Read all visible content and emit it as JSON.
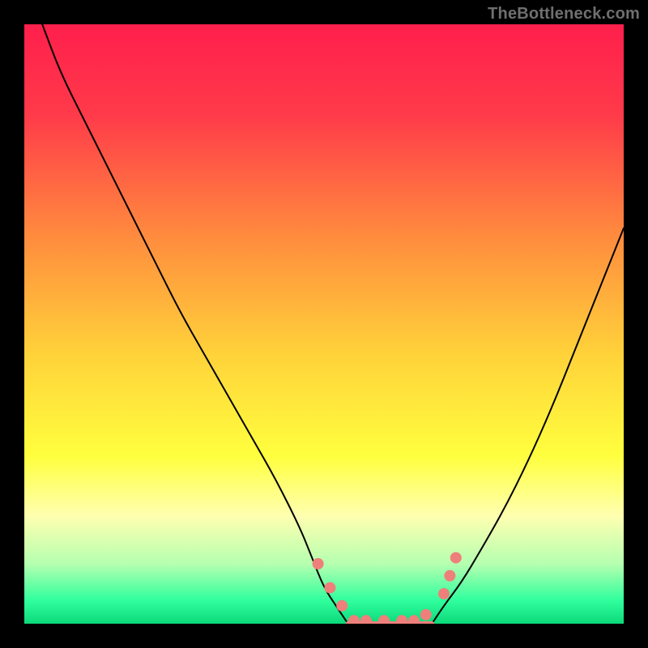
{
  "watermark": "TheBottleneck.com",
  "chart_data": {
    "type": "line",
    "title": "",
    "xlabel": "",
    "ylabel": "",
    "xlim": [
      0,
      100
    ],
    "ylim": [
      0,
      100
    ],
    "grid": false,
    "legend": false,
    "background_gradient": {
      "stops": [
        {
          "offset": 0.0,
          "color": "#ff1f4c"
        },
        {
          "offset": 0.15,
          "color": "#ff3a4a"
        },
        {
          "offset": 0.35,
          "color": "#ff8a3e"
        },
        {
          "offset": 0.55,
          "color": "#ffd23a"
        },
        {
          "offset": 0.72,
          "color": "#ffff3e"
        },
        {
          "offset": 0.82,
          "color": "#ffffb0"
        },
        {
          "offset": 0.9,
          "color": "#b6ffb0"
        },
        {
          "offset": 0.96,
          "color": "#32ff9e"
        },
        {
          "offset": 1.0,
          "color": "#0cd97a"
        }
      ]
    },
    "series": [
      {
        "name": "left-curve",
        "color": "#000000",
        "width": 2,
        "x": [
          3,
          6,
          10,
          14,
          18,
          22,
          26,
          30,
          34,
          38,
          42,
          46,
          48,
          50,
          52,
          54
        ],
        "y": [
          100,
          92,
          84,
          76,
          68,
          60,
          52,
          45,
          38,
          31,
          24,
          16,
          11,
          6,
          3,
          0
        ]
      },
      {
        "name": "right-curve",
        "color": "#000000",
        "width": 2,
        "x": [
          68,
          70,
          73,
          76,
          80,
          84,
          88,
          92,
          96,
          100
        ],
        "y": [
          0,
          3,
          7,
          12,
          19,
          27,
          36,
          46,
          56,
          66
        ]
      },
      {
        "name": "valley-floor",
        "color": "#ef7f7a",
        "width": 6,
        "x": [
          54,
          56,
          58,
          60,
          62,
          64,
          66,
          68
        ],
        "y": [
          0,
          0,
          0,
          0,
          0,
          0,
          0,
          0
        ]
      }
    ],
    "markers": {
      "name": "scatter-points",
      "color": "#ef7f7a",
      "radius": 7,
      "points": [
        {
          "x": 49,
          "y": 10
        },
        {
          "x": 51,
          "y": 6
        },
        {
          "x": 53,
          "y": 3
        },
        {
          "x": 55,
          "y": 0.5
        },
        {
          "x": 57,
          "y": 0.5
        },
        {
          "x": 60,
          "y": 0.5
        },
        {
          "x": 63,
          "y": 0.5
        },
        {
          "x": 65,
          "y": 0.5
        },
        {
          "x": 67,
          "y": 1.5
        },
        {
          "x": 70,
          "y": 5
        },
        {
          "x": 71,
          "y": 8
        },
        {
          "x": 72,
          "y": 11
        }
      ]
    }
  }
}
